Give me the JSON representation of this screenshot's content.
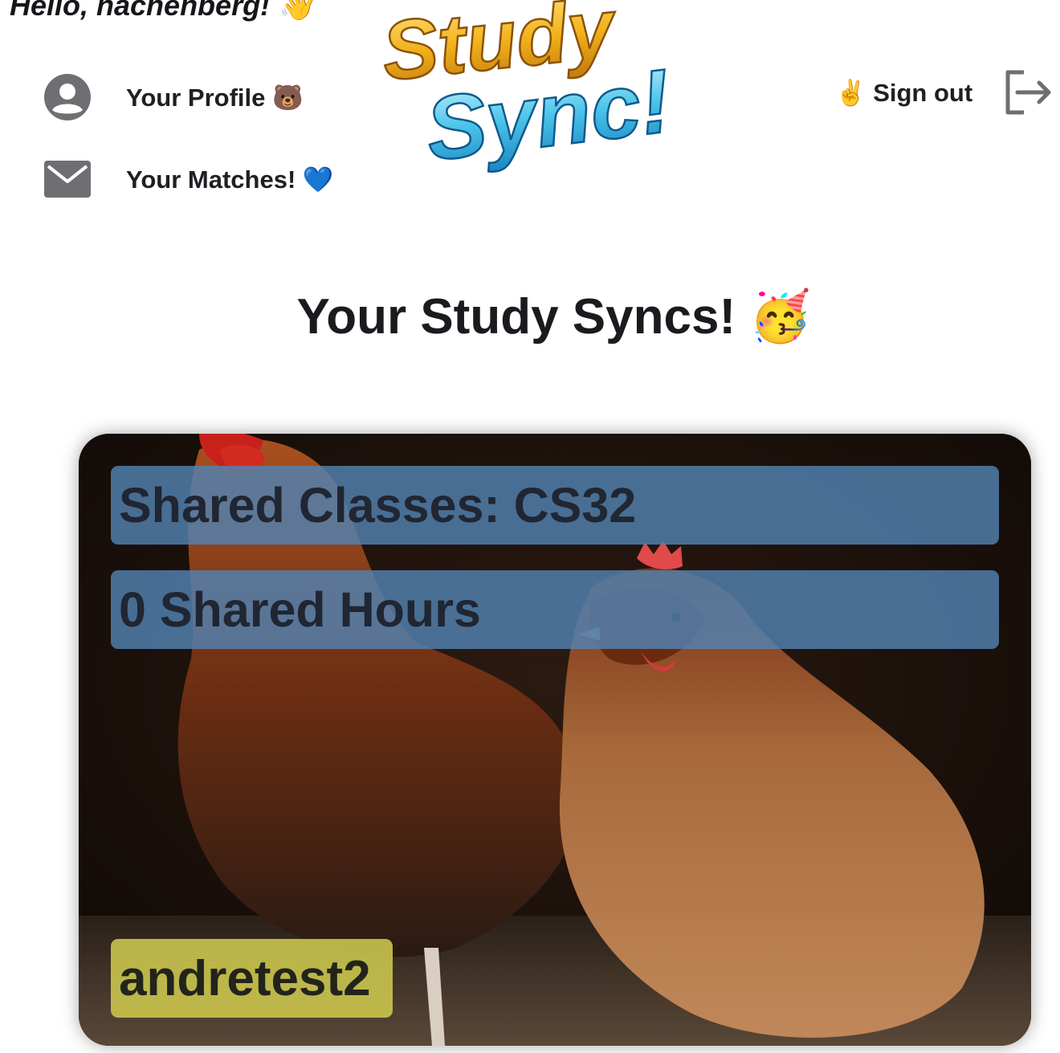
{
  "header": {
    "greeting": "Hello, nachenberg! 👋",
    "logo": {
      "line1": "Study",
      "line2": "Sync!"
    },
    "sign_out": {
      "label": "✌️ Sign out",
      "icon": "exit-icon"
    }
  },
  "nav": {
    "profile": {
      "label": "Your Profile 🐻",
      "icon": "user-circle-icon"
    },
    "matches": {
      "label": "Your Matches! 💙",
      "icon": "envelope-icon"
    }
  },
  "main": {
    "title": "Your Study Syncs! 🥳",
    "match_card": {
      "shared_classes": "Shared Classes: CS32",
      "shared_hours": "0 Shared Hours",
      "username": "andretest2"
    }
  },
  "colors": {
    "info_bar": "#5282b2",
    "name_tag": "#cac44e",
    "text": "#1f1f24"
  }
}
